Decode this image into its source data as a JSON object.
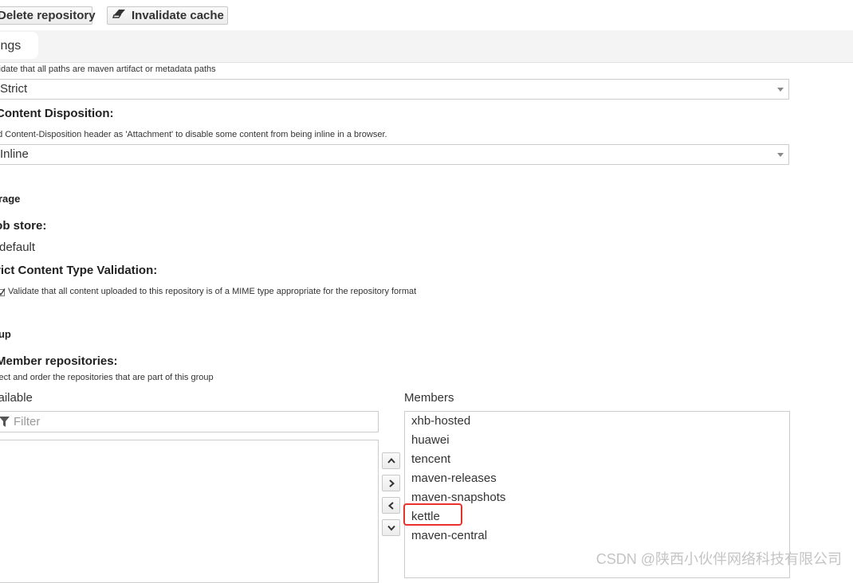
{
  "toolbar": {
    "delete_label": "Delete repository",
    "invalidate_label": "Invalidate cache"
  },
  "tabs": [
    {
      "label": "ttings"
    }
  ],
  "validation": {
    "help": "alidate that all paths are maven artifact or metadata paths",
    "value": "Strict"
  },
  "content_disposition": {
    "label": "Content Disposition:",
    "help": "dd Content-Disposition header as 'Attachment' to disable some content from being inline in a browser.",
    "value": "Inline"
  },
  "storage": {
    "section_title": "orage",
    "blob_store_label": "lob store:",
    "blob_store_value": "default",
    "strict_label": "trict Content Type Validation:",
    "strict_checked": true,
    "strict_help": "Validate that all content uploaded to this repository is of a MIME type appropriate for the repository format"
  },
  "group": {
    "section_title": "oup",
    "members_label": "Member repositories:",
    "members_help": "elect and order the repositories that are part of this group",
    "available_title": "vailable",
    "filter_placeholder": "Filter",
    "members_title": "Members",
    "members": [
      "xhb-hosted",
      "huawei",
      "tencent",
      "maven-releases",
      "maven-snapshots",
      "kettle",
      "maven-central"
    ],
    "highlighted_member": "kettle"
  },
  "watermark": "CSDN @陕西小伙伴网络科技有限公司",
  "icons": {
    "invalidate": "eraser-icon",
    "filter": "filter-icon",
    "checkbox": "checkbox-checked-icon",
    "caret": "caret-down-icon",
    "arrows": [
      "chevron-up-icon",
      "chevron-right-icon",
      "chevron-left-icon",
      "chevron-down-icon"
    ]
  },
  "colors": {
    "highlight": "#e8322b",
    "tabbar_bg": "#f4f4f4",
    "border": "#cccccc"
  }
}
